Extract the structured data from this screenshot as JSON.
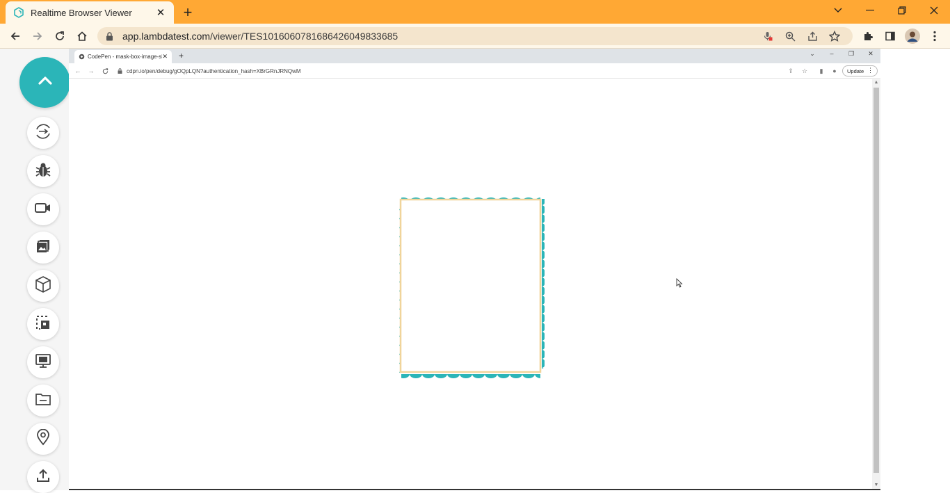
{
  "outer_browser": {
    "tab_title": "Realtime Browser Viewer",
    "url_host": "app.lambdatest.com",
    "url_path": "/viewer/TES1016060781686426049833685",
    "accent_color": "#ffa834"
  },
  "sidebar": {
    "fab_icon": "chevron-up-icon",
    "fab_color": "#2bb5b8",
    "buttons": [
      {
        "name": "switch-browser-button",
        "icon": "switch-icon"
      },
      {
        "name": "bug-report-button",
        "icon": "bug-icon"
      },
      {
        "name": "record-video-button",
        "icon": "video-camera-icon"
      },
      {
        "name": "screenshot-gallery-button",
        "icon": "gallery-icon"
      },
      {
        "name": "device-3d-button",
        "icon": "cube-icon"
      },
      {
        "name": "screenshot-select-button",
        "icon": "select-crop-icon"
      },
      {
        "name": "resolution-button",
        "icon": "monitor-icon"
      },
      {
        "name": "file-manager-button",
        "icon": "folder-icon"
      },
      {
        "name": "geolocation-button",
        "icon": "location-pin-icon"
      },
      {
        "name": "upload-button",
        "icon": "upload-icon"
      }
    ]
  },
  "inner_browser": {
    "tab_title": "CodePen - mask-box-image-slice",
    "url": "cdpn.io/pen/debug/gOQpLQN?authentication_hash=XBrGRnJRNQwM",
    "update_label": "Update"
  },
  "page_content": {
    "stamp_border_color": "#2bb5b8",
    "stamp_inner_border_color": "#f0d49a"
  }
}
